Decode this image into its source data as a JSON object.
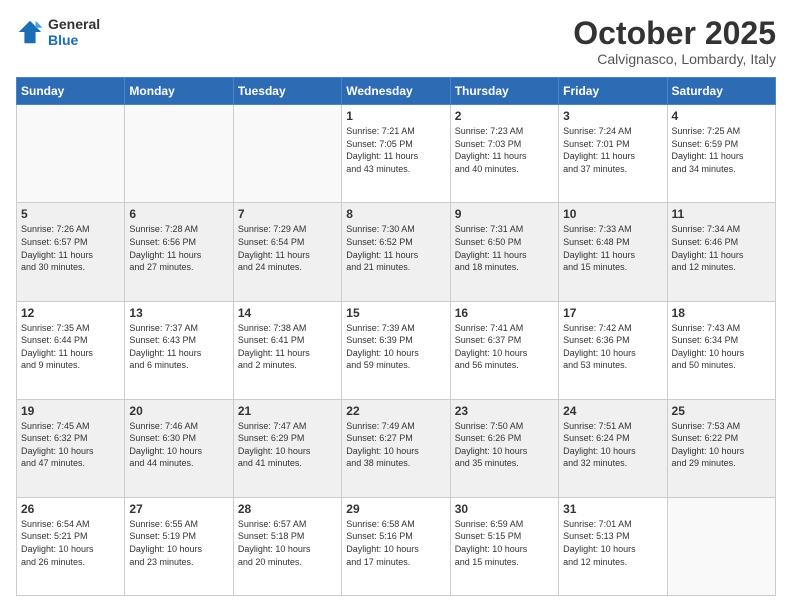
{
  "logo": {
    "line1": "General",
    "line2": "Blue"
  },
  "title": "October 2025",
  "location": "Calvignasco, Lombardy, Italy",
  "headers": [
    "Sunday",
    "Monday",
    "Tuesday",
    "Wednesday",
    "Thursday",
    "Friday",
    "Saturday"
  ],
  "weeks": [
    [
      {
        "day": "",
        "info": ""
      },
      {
        "day": "",
        "info": ""
      },
      {
        "day": "",
        "info": ""
      },
      {
        "day": "1",
        "info": "Sunrise: 7:21 AM\nSunset: 7:05 PM\nDaylight: 11 hours\nand 43 minutes."
      },
      {
        "day": "2",
        "info": "Sunrise: 7:23 AM\nSunset: 7:03 PM\nDaylight: 11 hours\nand 40 minutes."
      },
      {
        "day": "3",
        "info": "Sunrise: 7:24 AM\nSunset: 7:01 PM\nDaylight: 11 hours\nand 37 minutes."
      },
      {
        "day": "4",
        "info": "Sunrise: 7:25 AM\nSunset: 6:59 PM\nDaylight: 11 hours\nand 34 minutes."
      }
    ],
    [
      {
        "day": "5",
        "info": "Sunrise: 7:26 AM\nSunset: 6:57 PM\nDaylight: 11 hours\nand 30 minutes."
      },
      {
        "day": "6",
        "info": "Sunrise: 7:28 AM\nSunset: 6:56 PM\nDaylight: 11 hours\nand 27 minutes."
      },
      {
        "day": "7",
        "info": "Sunrise: 7:29 AM\nSunset: 6:54 PM\nDaylight: 11 hours\nand 24 minutes."
      },
      {
        "day": "8",
        "info": "Sunrise: 7:30 AM\nSunset: 6:52 PM\nDaylight: 11 hours\nand 21 minutes."
      },
      {
        "day": "9",
        "info": "Sunrise: 7:31 AM\nSunset: 6:50 PM\nDaylight: 11 hours\nand 18 minutes."
      },
      {
        "day": "10",
        "info": "Sunrise: 7:33 AM\nSunset: 6:48 PM\nDaylight: 11 hours\nand 15 minutes."
      },
      {
        "day": "11",
        "info": "Sunrise: 7:34 AM\nSunset: 6:46 PM\nDaylight: 11 hours\nand 12 minutes."
      }
    ],
    [
      {
        "day": "12",
        "info": "Sunrise: 7:35 AM\nSunset: 6:44 PM\nDaylight: 11 hours\nand 9 minutes."
      },
      {
        "day": "13",
        "info": "Sunrise: 7:37 AM\nSunset: 6:43 PM\nDaylight: 11 hours\nand 6 minutes."
      },
      {
        "day": "14",
        "info": "Sunrise: 7:38 AM\nSunset: 6:41 PM\nDaylight: 11 hours\nand 2 minutes."
      },
      {
        "day": "15",
        "info": "Sunrise: 7:39 AM\nSunset: 6:39 PM\nDaylight: 10 hours\nand 59 minutes."
      },
      {
        "day": "16",
        "info": "Sunrise: 7:41 AM\nSunset: 6:37 PM\nDaylight: 10 hours\nand 56 minutes."
      },
      {
        "day": "17",
        "info": "Sunrise: 7:42 AM\nSunset: 6:36 PM\nDaylight: 10 hours\nand 53 minutes."
      },
      {
        "day": "18",
        "info": "Sunrise: 7:43 AM\nSunset: 6:34 PM\nDaylight: 10 hours\nand 50 minutes."
      }
    ],
    [
      {
        "day": "19",
        "info": "Sunrise: 7:45 AM\nSunset: 6:32 PM\nDaylight: 10 hours\nand 47 minutes."
      },
      {
        "day": "20",
        "info": "Sunrise: 7:46 AM\nSunset: 6:30 PM\nDaylight: 10 hours\nand 44 minutes."
      },
      {
        "day": "21",
        "info": "Sunrise: 7:47 AM\nSunset: 6:29 PM\nDaylight: 10 hours\nand 41 minutes."
      },
      {
        "day": "22",
        "info": "Sunrise: 7:49 AM\nSunset: 6:27 PM\nDaylight: 10 hours\nand 38 minutes."
      },
      {
        "day": "23",
        "info": "Sunrise: 7:50 AM\nSunset: 6:26 PM\nDaylight: 10 hours\nand 35 minutes."
      },
      {
        "day": "24",
        "info": "Sunrise: 7:51 AM\nSunset: 6:24 PM\nDaylight: 10 hours\nand 32 minutes."
      },
      {
        "day": "25",
        "info": "Sunrise: 7:53 AM\nSunset: 6:22 PM\nDaylight: 10 hours\nand 29 minutes."
      }
    ],
    [
      {
        "day": "26",
        "info": "Sunrise: 6:54 AM\nSunset: 5:21 PM\nDaylight: 10 hours\nand 26 minutes."
      },
      {
        "day": "27",
        "info": "Sunrise: 6:55 AM\nSunset: 5:19 PM\nDaylight: 10 hours\nand 23 minutes."
      },
      {
        "day": "28",
        "info": "Sunrise: 6:57 AM\nSunset: 5:18 PM\nDaylight: 10 hours\nand 20 minutes."
      },
      {
        "day": "29",
        "info": "Sunrise: 6:58 AM\nSunset: 5:16 PM\nDaylight: 10 hours\nand 17 minutes."
      },
      {
        "day": "30",
        "info": "Sunrise: 6:59 AM\nSunset: 5:15 PM\nDaylight: 10 hours\nand 15 minutes."
      },
      {
        "day": "31",
        "info": "Sunrise: 7:01 AM\nSunset: 5:13 PM\nDaylight: 10 hours\nand 12 minutes."
      },
      {
        "day": "",
        "info": ""
      }
    ]
  ],
  "shading": [
    false,
    true,
    false,
    true,
    false
  ]
}
